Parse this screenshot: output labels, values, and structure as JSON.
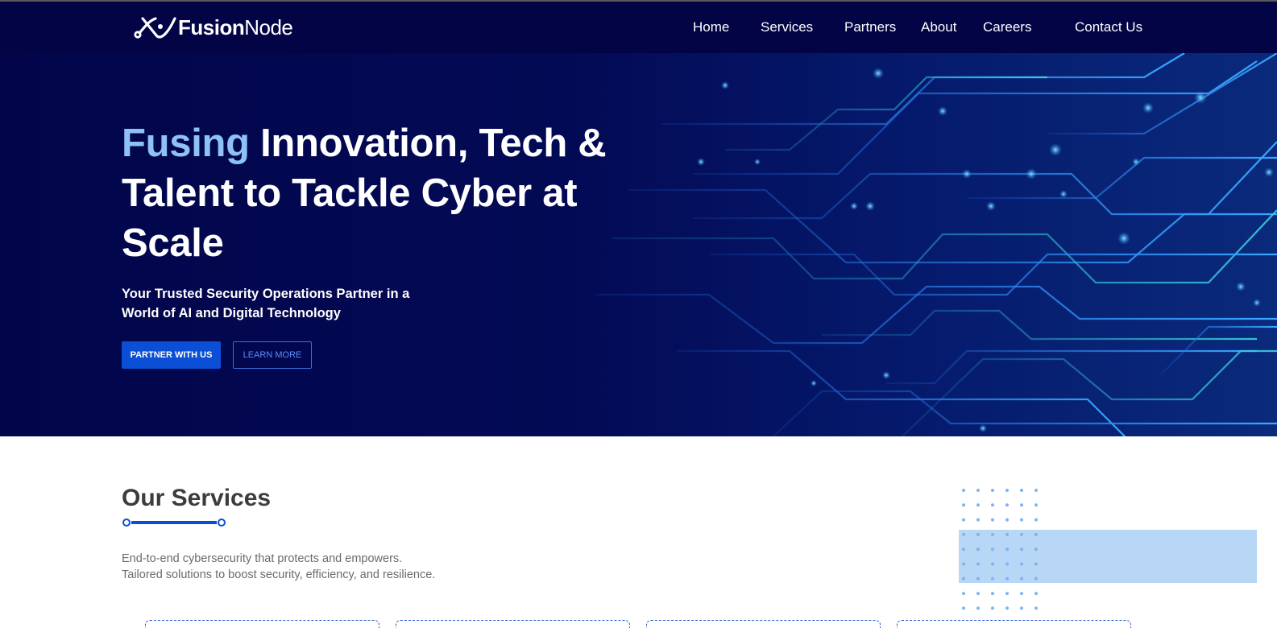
{
  "brand": {
    "name_bold": "Fusion",
    "name_light": "Node",
    "logo_icon": "fusion-x-icon"
  },
  "nav": {
    "items": [
      {
        "label": "Home"
      },
      {
        "label": "Services"
      },
      {
        "label": "Partners"
      },
      {
        "label": "About"
      },
      {
        "label": "Careers"
      },
      {
        "label": "Contact Us"
      }
    ]
  },
  "hero": {
    "title_accent": "Fusing",
    "title_rest": " Innovation, Tech & Talent to Tackle Cyber at Scale",
    "subtitle": "Your Trusted Security Operations Partner in a World of AI and Digital Technology",
    "primary_button": "PARTNER WITH US",
    "secondary_button": "LEARN MORE",
    "background_icon": "circuit-board-pattern"
  },
  "services": {
    "title": "Our Services",
    "description_line1": "End-to-end cybersecurity that protects and empowers.",
    "description_line2": "Tailored solutions to boost security, efficiency, and resilience."
  },
  "colors": {
    "nav_bg": "#020445",
    "accent": "#8ec2f5",
    "primary_button": "#0a4fd6",
    "heading_dark": "#3c3c3c",
    "decor_light_blue": "#b8d6f6"
  }
}
